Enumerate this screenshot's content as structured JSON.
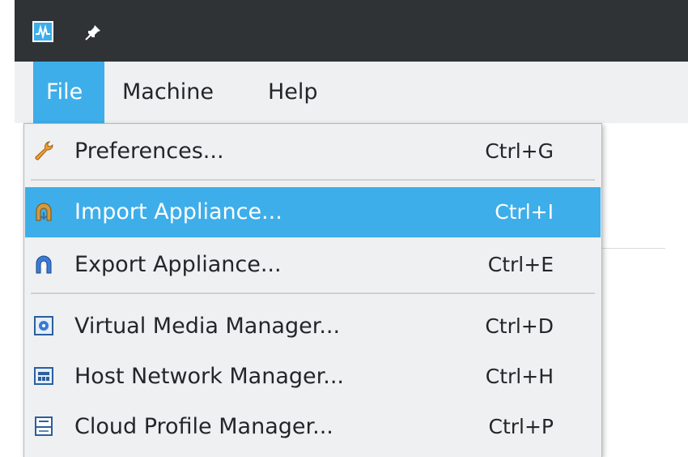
{
  "titlebar": {
    "app_icon": "virtualbox-monitor-icon",
    "pin_icon": "pin-icon"
  },
  "menubar": {
    "items": [
      {
        "label": "File",
        "active": true
      },
      {
        "label": "Machine",
        "active": false
      },
      {
        "label": "Help",
        "active": false
      }
    ]
  },
  "file_menu": {
    "items": [
      {
        "label": "Preferences...",
        "shortcut": "Ctrl+G",
        "icon": "wrench-icon"
      },
      {
        "label": "Import Appliance...",
        "shortcut": "Ctrl+I",
        "icon": "import-appliance-icon",
        "highlighted": true
      },
      {
        "label": "Export Appliance...",
        "shortcut": "Ctrl+E",
        "icon": "export-appliance-icon"
      },
      {
        "label": "Virtual Media Manager...",
        "shortcut": "Ctrl+D",
        "icon": "virtual-media-icon"
      },
      {
        "label": "Host Network Manager...",
        "shortcut": "Ctrl+H",
        "icon": "host-network-icon"
      },
      {
        "label": "Cloud Profile Manager...",
        "shortcut": "Ctrl+P",
        "icon": "cloud-profile-icon"
      }
    ]
  },
  "colors": {
    "accent": "#3daee9",
    "titlebar": "#2f3336",
    "menu_bg": "#eff0f1"
  }
}
